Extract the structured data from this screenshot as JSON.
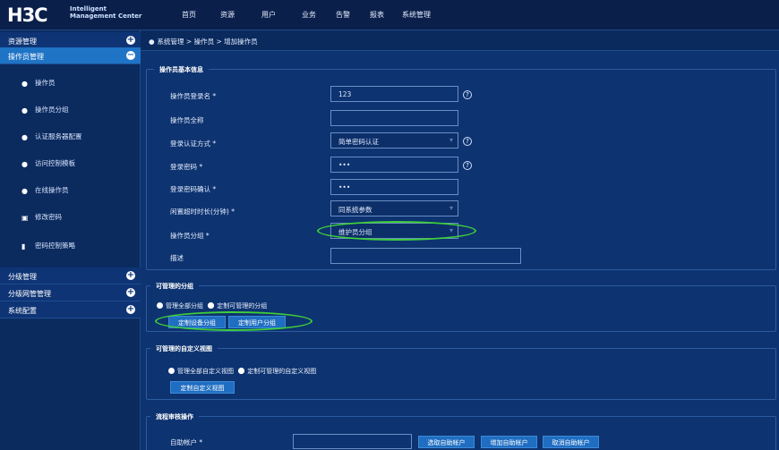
{
  "header": {
    "logo": "H3C",
    "logo_sub_1": "Intelligent",
    "logo_sub_2": "Management Center",
    "nav": [
      "首页",
      "资源",
      "用户",
      "业务",
      "告警",
      "报表",
      "系统管理"
    ]
  },
  "sidebar": {
    "groups": [
      {
        "label": "资源管理",
        "icon": "plus-circle-icon"
      },
      {
        "label": "操作员管理",
        "icon": "minus-circle-icon"
      },
      {
        "label": "分级管理",
        "icon": "plus-circle-icon"
      },
      {
        "label": "分级网管管理",
        "icon": "plus-circle-icon"
      },
      {
        "label": "系统配置",
        "icon": "plus-circle-icon"
      }
    ],
    "items": [
      {
        "label": "操作员",
        "icon": "user-icon"
      },
      {
        "label": "操作员分组",
        "icon": "user-group-icon"
      },
      {
        "label": "认证服务器配置",
        "icon": "user-gear-icon"
      },
      {
        "label": "访问控制模板",
        "icon": "user-key-icon"
      },
      {
        "label": "在线操作员",
        "icon": "user-online-icon"
      },
      {
        "label": "修改密码",
        "icon": "password-edit-icon"
      },
      {
        "label": "密码控制策略",
        "icon": "lock-icon"
      }
    ]
  },
  "breadcrumb": "系统管理 > 操作员 > 增加操作员",
  "basic": {
    "title": "操作员基本信息",
    "login_name_label": "操作员登录名 *",
    "login_name_value": "123",
    "full_name_label": "操作员全称",
    "full_name_value": "",
    "auth_label": "登录认证方式 *",
    "auth_value": "简单密码认证",
    "password_label": "登录密码 *",
    "password_value": "•••",
    "confirm_label": "登录密码确认 *",
    "confirm_value": "•••",
    "timeout_label": "闲置超时时长(分钟) *",
    "timeout_value": "同系统参数",
    "group_label": "操作员分组 *",
    "group_value": "维护员分组",
    "desc_label": "描述",
    "desc_value": ""
  },
  "manageable": {
    "title": "可管理的分组",
    "opt_all": "管理全部分组",
    "opt_custom": "定制可管理的分组",
    "btn_device": "定制设备分组",
    "btn_user": "定制用户分组"
  },
  "views": {
    "title": "可管理的自定义视图",
    "opt_all": "管理全部自定义视图",
    "opt_custom": "定制可管理的自定义视图",
    "btn_custom": "定制自定义视图"
  },
  "approval": {
    "title": "流程审核操作",
    "self_account_label": "自助帐户 *",
    "btn_select": "选取自助帐户",
    "btn_add": "增加自助帐户",
    "btn_cancel": "取消自助帐户"
  },
  "colors": {
    "highlight": "#3fcf3a",
    "accent": "#1f74c6"
  }
}
